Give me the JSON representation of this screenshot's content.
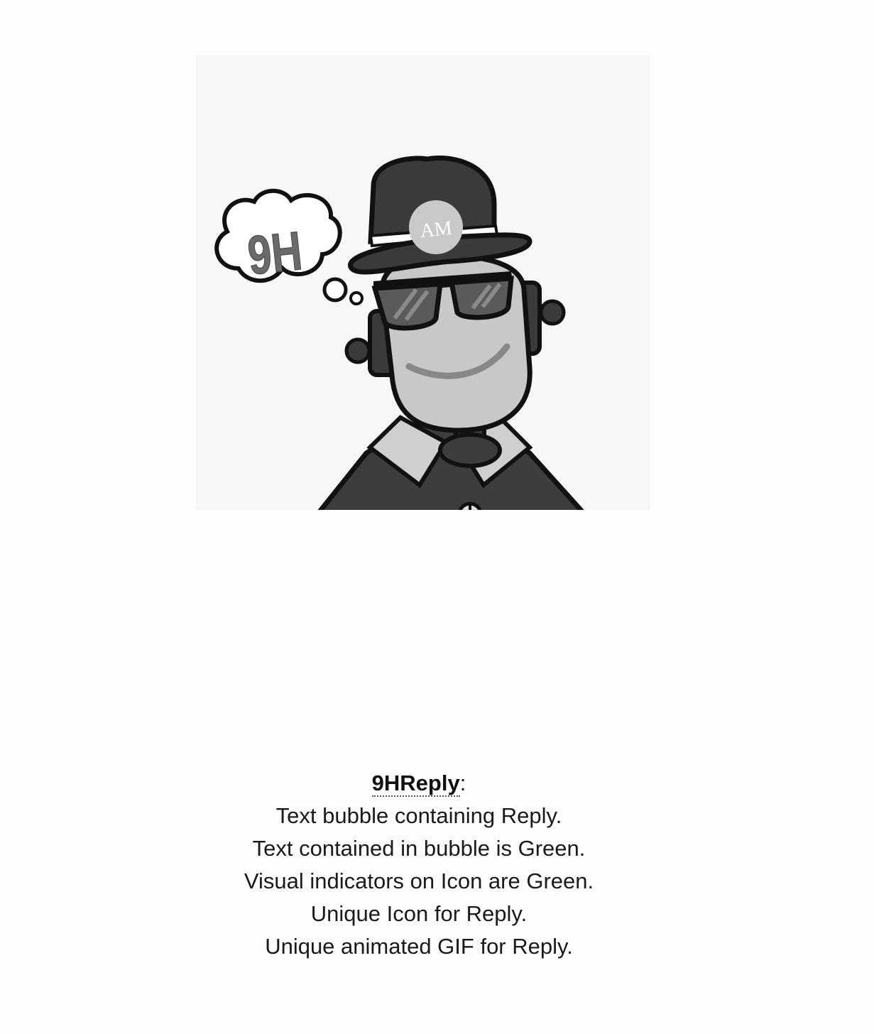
{
  "image": {
    "thought_bubble_text": "9H",
    "hat_badge_text": "AM"
  },
  "caption": {
    "term": "9HReply",
    "term_suffix": ":",
    "lines": [
      "Text bubble containing Reply.",
      "Text contained in bubble is Green.",
      "Visual indicators on Icon are Green.",
      "Unique Icon for Reply.",
      "Unique animated GIF for Reply."
    ]
  },
  "colors": {
    "background": "#fdfdfd",
    "image_background": "#f7f7f7",
    "outline": "#111111",
    "hat": "#3a3a3a",
    "face": "#c8c8c8",
    "lens": "#5a5a5a",
    "collar": "#cfcfcf",
    "body": "#3d3d3d"
  },
  "icons": [
    "robot-mascot-illustration",
    "thought-bubble"
  ]
}
